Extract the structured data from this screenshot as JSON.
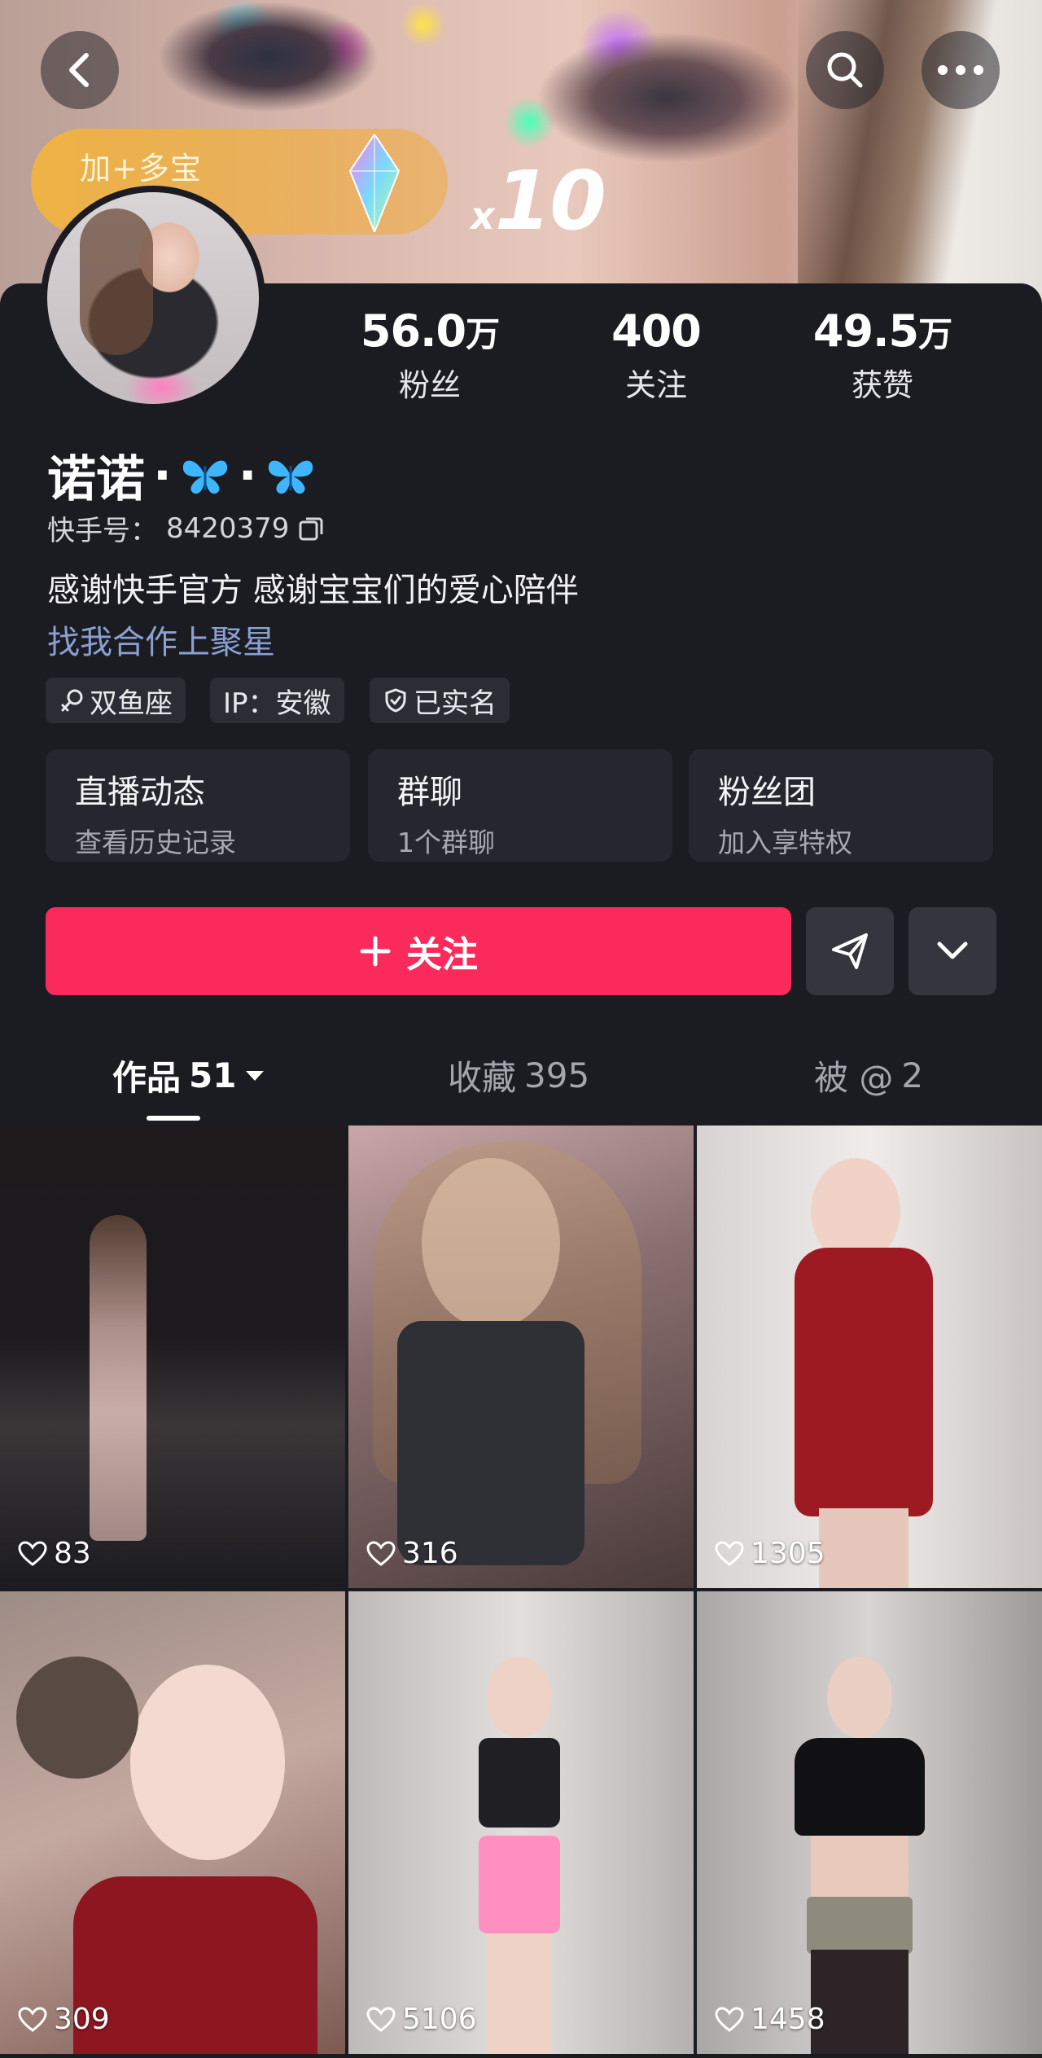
{
  "header": {
    "promo": {
      "line1": "加+多宝",
      "multiplier_x": "x",
      "multiplier_num": "10"
    }
  },
  "stats": [
    {
      "value": "56.0",
      "unit": "万",
      "label": "粉丝"
    },
    {
      "value": "400",
      "unit": "",
      "label": "关注"
    },
    {
      "value": "49.5",
      "unit": "万",
      "label": "获赞"
    }
  ],
  "profile": {
    "name": "诺诺",
    "name_sep": "·",
    "kuaishou_id_label": "快手号：",
    "kuaishou_id": "8420379",
    "bio": "感谢快手官方 感谢宝宝们的爱心陪伴",
    "business_link": "找我合作上聚星",
    "tags": {
      "zodiac": "双鱼座",
      "ip": "IP：安徽",
      "verified": "已实名"
    }
  },
  "tiles": [
    {
      "title": "直播动态",
      "subtitle": "查看历史记录"
    },
    {
      "title": "群聊",
      "subtitle": "1个群聊"
    },
    {
      "title": "粉丝团",
      "subtitle": "加入享特权"
    }
  ],
  "actions": {
    "follow_label": "关注"
  },
  "tabs": [
    {
      "label": "作品",
      "count": "51"
    },
    {
      "label": "收藏",
      "count": "395"
    },
    {
      "label": "被 @",
      "count": "2"
    }
  ],
  "posts": [
    {
      "likes": "83"
    },
    {
      "likes": "316"
    },
    {
      "likes": "1305"
    },
    {
      "likes": "309"
    },
    {
      "likes": "5106"
    },
    {
      "likes": "1458"
    }
  ],
  "colors": {
    "follow_button": "#fa2b5c",
    "background": "#1b1b22",
    "link": "#8aa0d0"
  }
}
